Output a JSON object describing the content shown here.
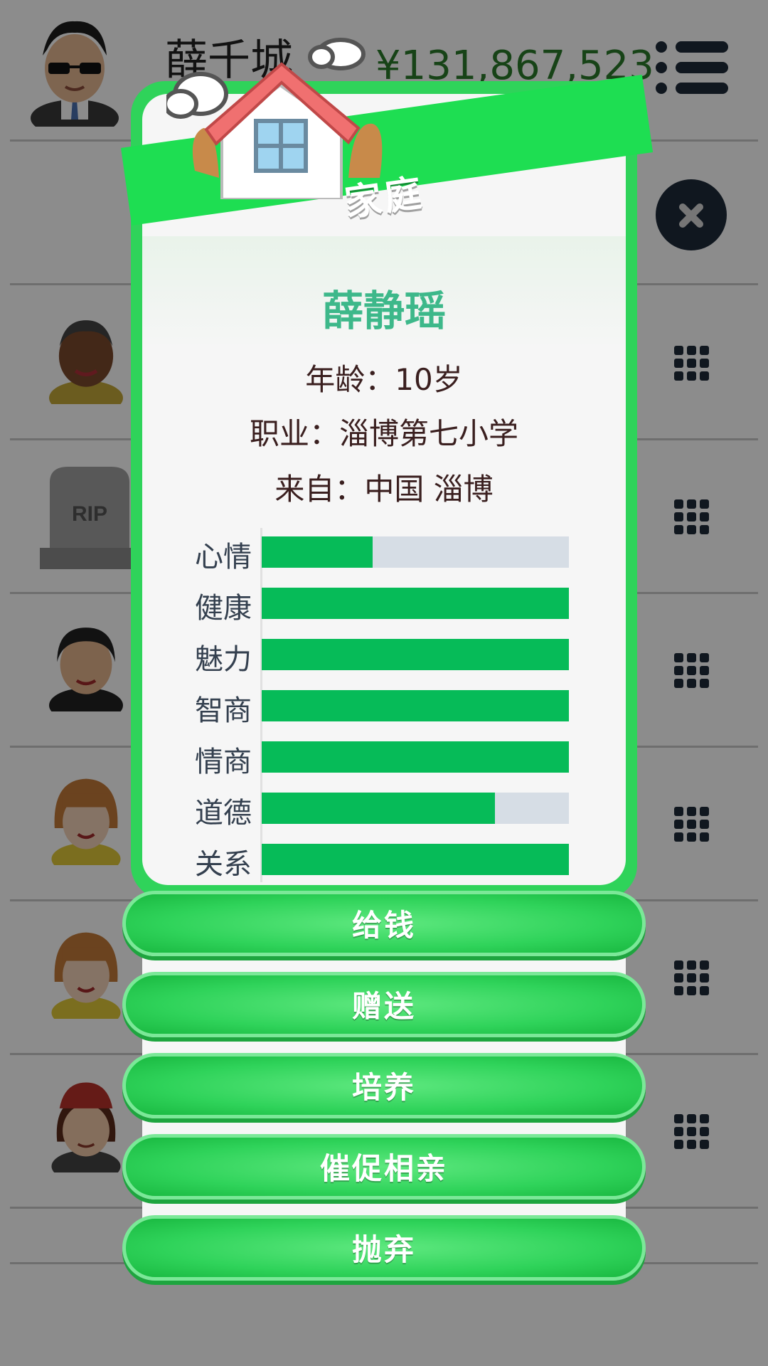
{
  "header": {
    "player_name": "薛千城",
    "money": "¥131,867,523"
  },
  "dialog": {
    "title": "家庭",
    "member_name": "薛静瑶",
    "age_label": "年龄：",
    "age_value": "10岁",
    "job_label": "职业：",
    "job_value": "淄博第七小学",
    "from_label": "来自：",
    "from_value": "中国 淄博",
    "stats": [
      {
        "label": "心情",
        "value": 0.36
      },
      {
        "label": "健康",
        "value": 1.0
      },
      {
        "label": "魅力",
        "value": 1.0
      },
      {
        "label": "智商",
        "value": 1.0
      },
      {
        "label": "情商",
        "value": 1.0
      },
      {
        "label": "道德",
        "value": 0.76
      },
      {
        "label": "关系",
        "value": 1.0
      }
    ],
    "actions": [
      "给钱",
      "赠送",
      "培养",
      "催促相亲",
      "抛弃"
    ]
  },
  "list": {
    "tombstone_text": "RIP"
  },
  "colors": {
    "accent_green": "#2fd35a",
    "bar_fill": "#06bb58",
    "bar_track": "#d6dde5",
    "name_teal": "#3db88a"
  }
}
